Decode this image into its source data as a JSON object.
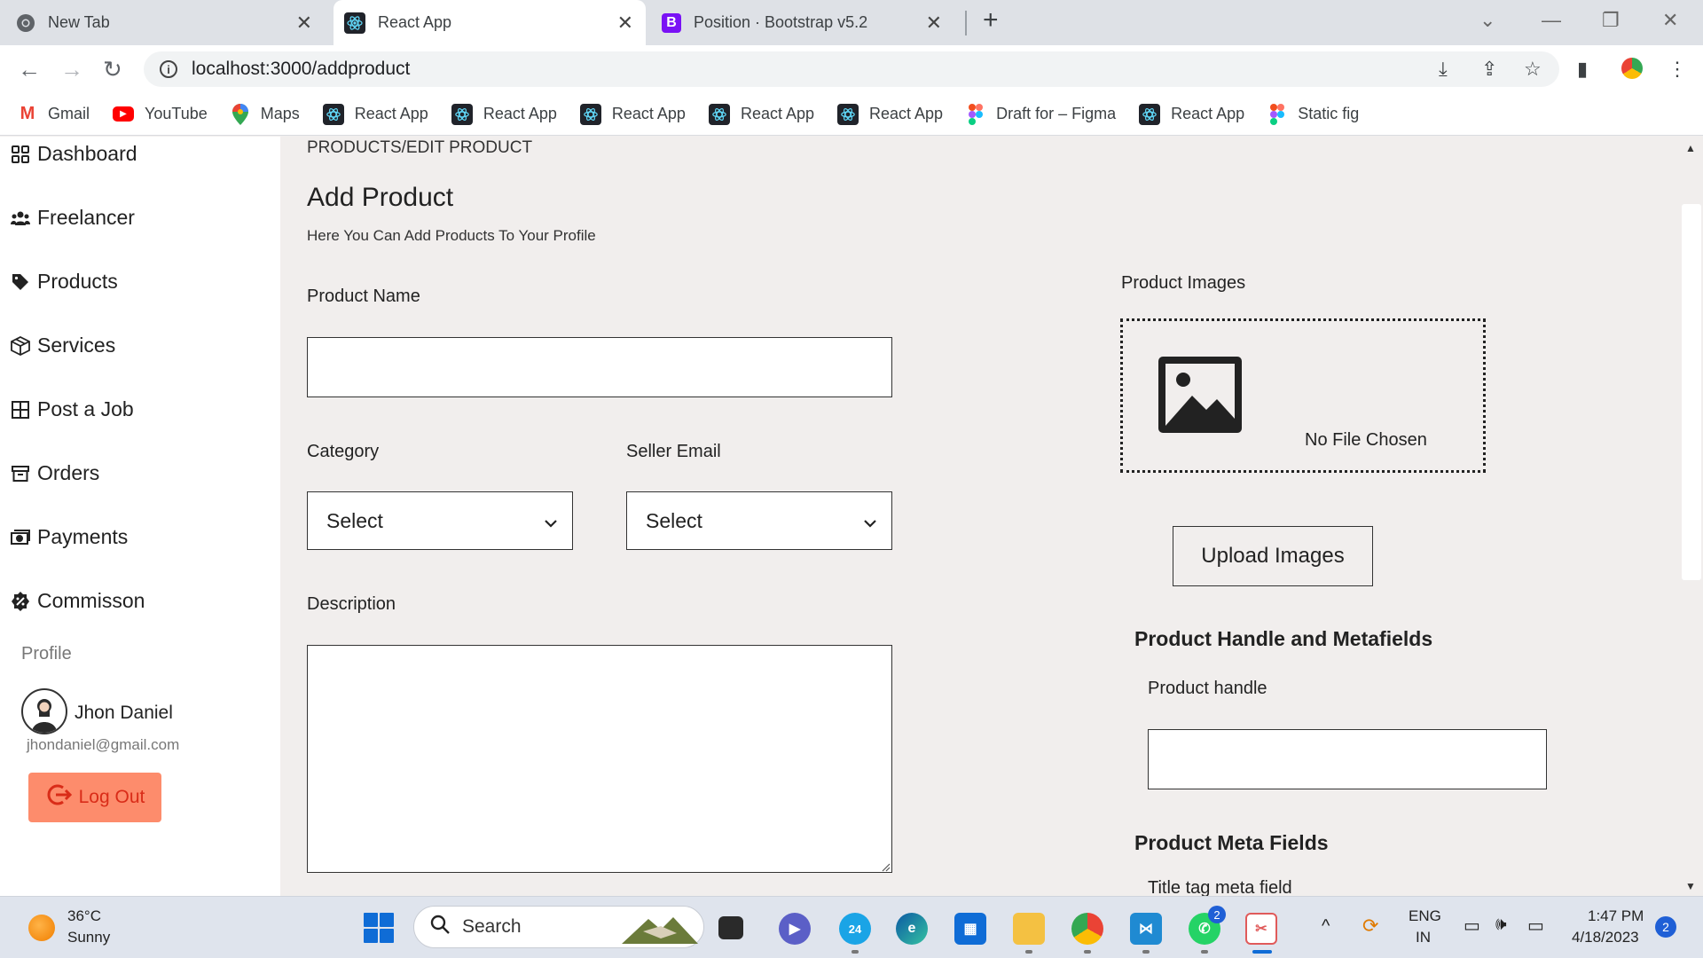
{
  "browser": {
    "tabs": [
      {
        "title": "New Tab",
        "active": false,
        "icon": "chrome-icon"
      },
      {
        "title": "React App",
        "active": true,
        "icon": "react-icon"
      },
      {
        "title": "Position · Bootstrap v5.2",
        "active": false,
        "icon": "bootstrap-icon"
      }
    ],
    "url": "localhost:3000/addproduct",
    "bookmarks": [
      {
        "label": "Gmail",
        "icon": "gmail-icon"
      },
      {
        "label": "YouTube",
        "icon": "youtube-icon"
      },
      {
        "label": "Maps",
        "icon": "maps-icon"
      },
      {
        "label": "React App",
        "icon": "react-icon"
      },
      {
        "label": "React App",
        "icon": "react-icon"
      },
      {
        "label": "React App",
        "icon": "react-icon"
      },
      {
        "label": "React App",
        "icon": "react-icon"
      },
      {
        "label": "React App",
        "icon": "react-icon"
      },
      {
        "label": "Draft for – Figma",
        "icon": "figma-icon"
      },
      {
        "label": "React App",
        "icon": "react-icon"
      },
      {
        "label": "Static fig",
        "icon": "figma-icon"
      }
    ]
  },
  "sidebar": {
    "items": [
      {
        "label": "Dashboard",
        "icon": "dashboard-icon"
      },
      {
        "label": "Freelancer",
        "icon": "users-icon"
      },
      {
        "label": "Products",
        "icon": "tag-icon"
      },
      {
        "label": "Services",
        "icon": "box-icon"
      },
      {
        "label": "Post a Job",
        "icon": "grid-icon"
      },
      {
        "label": "Orders",
        "icon": "archive-icon"
      },
      {
        "label": "Payments",
        "icon": "money-icon"
      },
      {
        "label": "Commisson",
        "icon": "badge-percent-icon"
      }
    ],
    "profile_heading": "Profile",
    "user_name": "Jhon Daniel",
    "user_email": "jhondaniel@gmail.com",
    "logout_label": "Log Out"
  },
  "main": {
    "breadcrumb": "PRODUCTS/EDIT PRODUCT",
    "title": "Add Product",
    "subtitle": "Here You Can Add Products To Your Profile",
    "product_name_label": "Product Name",
    "product_name_value": "",
    "category_label": "Category",
    "category_value": "Select",
    "seller_email_label": "Seller Email",
    "seller_email_value": "Select",
    "description_label": "Description",
    "description_value": "",
    "images_label": "Product Images",
    "no_file_text": "No File Chosen",
    "upload_label": "Upload Images",
    "handle_section_title": "Product Handle and Metafields",
    "handle_label": "Product handle",
    "handle_value": "",
    "meta_section_title": "Product Meta Fields",
    "title_tag_label": "Title tag meta field"
  },
  "taskbar": {
    "weather_temp": "36°C",
    "weather_condition": "Sunny",
    "search_placeholder": "Search",
    "language": "ENG",
    "region": "IN",
    "time": "1:47 PM",
    "date": "4/18/2023",
    "notification_count": "2",
    "whatsapp_badge": "2",
    "calendar_day": "24"
  },
  "colors": {
    "page_background": "#f1eeed",
    "logout_background": "#fd8c6c",
    "logout_text": "#d92c18",
    "accent": "#0f6cd6"
  }
}
